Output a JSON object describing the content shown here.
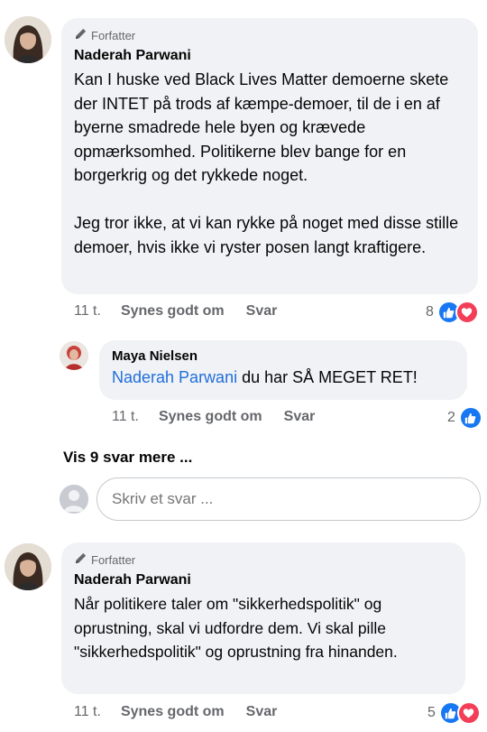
{
  "comments": [
    {
      "author_badge": "Forfatter",
      "author": "Naderah Parwani",
      "text": "Kan I huske ved Black Lives Matter demoerne skete der INTET på trods af kæmpe-demoer, til de i en af byerne smadrede hele byen og krævede opmærksomhed. Politikerne blev bange for en borgerkrig og det rykkede noget.\n\nJeg tror ikke, at vi kan rykke på noget med disse stille demoer, hvis ikke vi ryster posen langt kraftigere.",
      "time": "11 t.",
      "like_label": "Synes godt om",
      "reply_label": "Svar",
      "reaction_count": "8"
    },
    {
      "author_badge": "Forfatter",
      "author": "Naderah Parwani",
      "text": "Når politikere taler om \"sikkerhedspolitik\" og oprustning, skal vi udfordre dem. Vi skal pille \"sikkerhedspolitik\" og oprustning fra hinanden.",
      "time": "11 t.",
      "like_label": "Synes godt om",
      "reply_label": "Svar",
      "reaction_count": "5"
    }
  ],
  "reply": {
    "author": "Maya Nielsen",
    "mention": "Naderah Parwani",
    "text": " du har SÅ MEGET RET!",
    "time": "11 t.",
    "like_label": "Synes godt om",
    "reply_label": "Svar",
    "reaction_count": "2"
  },
  "more_replies": "Vis 9 svar mere ...",
  "reply_input": {
    "placeholder": "Skriv et svar ..."
  },
  "colors": {
    "bubble": "#f0f2f5",
    "like": "#1877f2",
    "love": "#f33e58",
    "mention": "#216fdb",
    "meta": "#65676b"
  }
}
